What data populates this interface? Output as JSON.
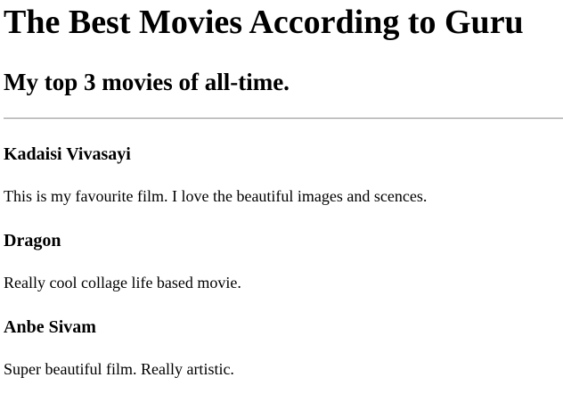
{
  "page": {
    "title": "The Best Movies According to Guru",
    "subtitle": "My top 3 movies of all-time."
  },
  "movies": [
    {
      "title": "Kadaisi Vivasayi",
      "description": "This is my favourite film. I love the beautiful images and scences."
    },
    {
      "title": "Dragon",
      "description": "Really cool collage life based movie."
    },
    {
      "title": "Anbe Sivam",
      "description": "Super beautiful film. Really artistic."
    }
  ]
}
